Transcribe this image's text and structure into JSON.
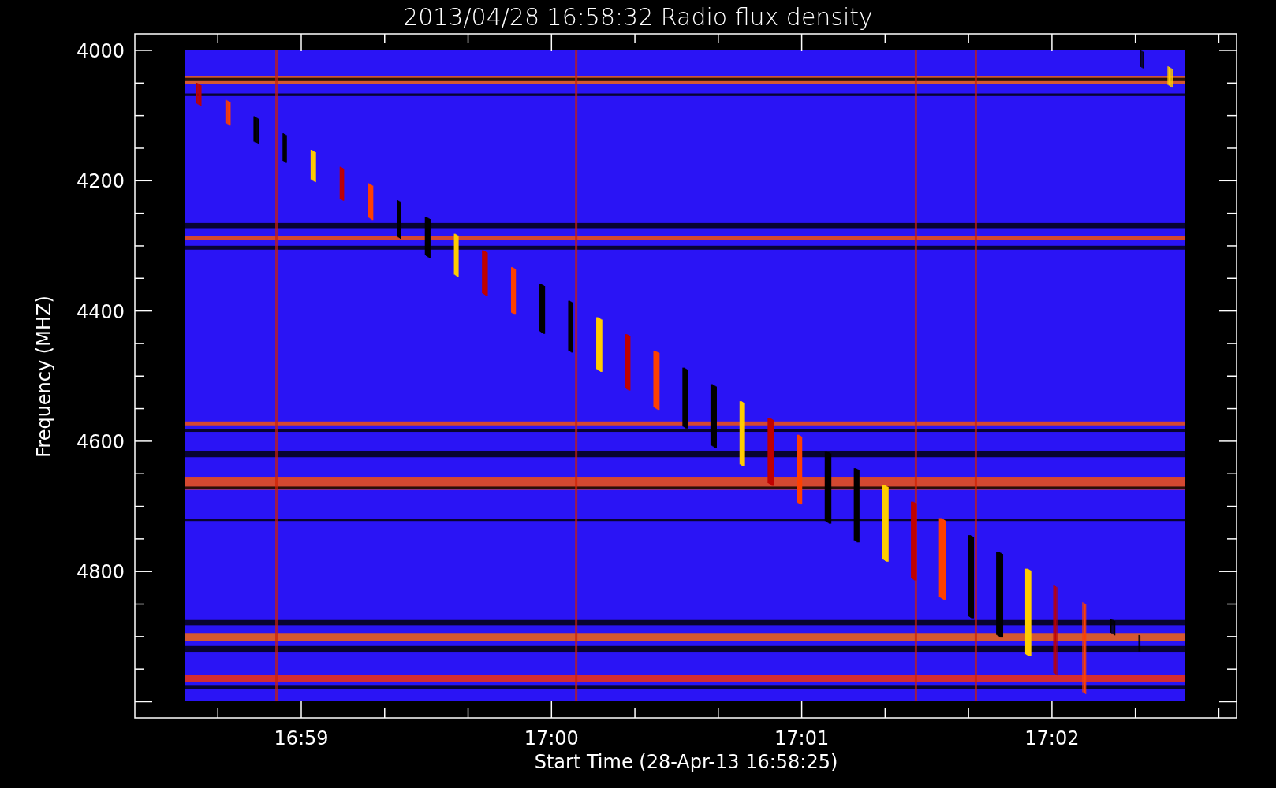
{
  "title": "2013/04/28 16:58:32 Radio flux density",
  "y_axis": {
    "label": "Frequency (MHZ)",
    "ticks": [
      "4000",
      "4200",
      "4400",
      "4600",
      "4800"
    ]
  },
  "x_axis": {
    "label": "Start Time (28-Apr-13 16:58:25)",
    "ticks": [
      "16:59",
      "17:00",
      "17:01",
      "17:02"
    ]
  }
}
